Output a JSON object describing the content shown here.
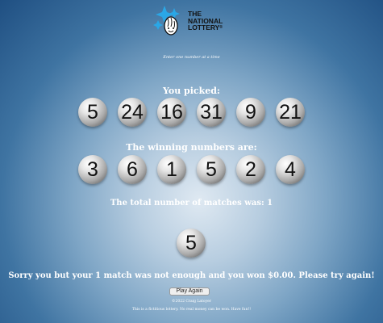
{
  "logo": {
    "brand_line1": "THE",
    "brand_line2": "NATIONAL",
    "brand_line3": "LOTTERY",
    "reg": "®",
    "icon": "crossed-fingers-icon"
  },
  "instruction": "Enter one number at a time",
  "picked": {
    "heading": "You picked:",
    "numbers": [
      "5",
      "24",
      "16",
      "31",
      "9",
      "21"
    ]
  },
  "winning": {
    "heading": "The winning numbers are:",
    "numbers": [
      "3",
      "6",
      "1",
      "5",
      "2",
      "4"
    ]
  },
  "matches": {
    "heading": "The total number of matches was: 1",
    "numbers": [
      "5"
    ]
  },
  "result_message": "Sorry you but your 1 match was not enough and you won $0.00. Please try again!",
  "play_again_label": "Play Again",
  "footer": {
    "copyright": "©2022 Craig Latoyer",
    "disclaimer": "This is a fictitious lottery. No real money can be won. Have fun!!"
  },
  "colors": {
    "background_center": "#dfe9f2",
    "background_edge": "#1f4f82",
    "logo_star": "#2aa7e6",
    "text": "#ffffff"
  }
}
